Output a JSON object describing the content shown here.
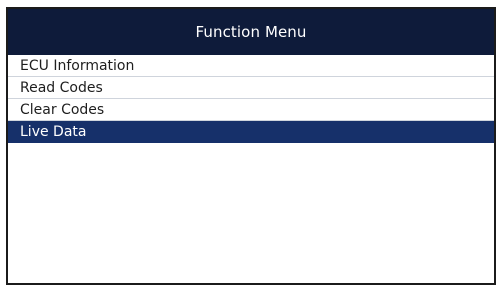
{
  "header": {
    "title": "Function Menu"
  },
  "menu": {
    "items": [
      {
        "label": "ECU Information",
        "selected": false
      },
      {
        "label": "Read Codes",
        "selected": false
      },
      {
        "label": "Clear Codes",
        "selected": false
      },
      {
        "label": "Live Data",
        "selected": true
      }
    ]
  },
  "colors": {
    "header_bg": "#0e1b3a",
    "selected_bg": "#16306a",
    "divider": "#cfd4dc"
  }
}
